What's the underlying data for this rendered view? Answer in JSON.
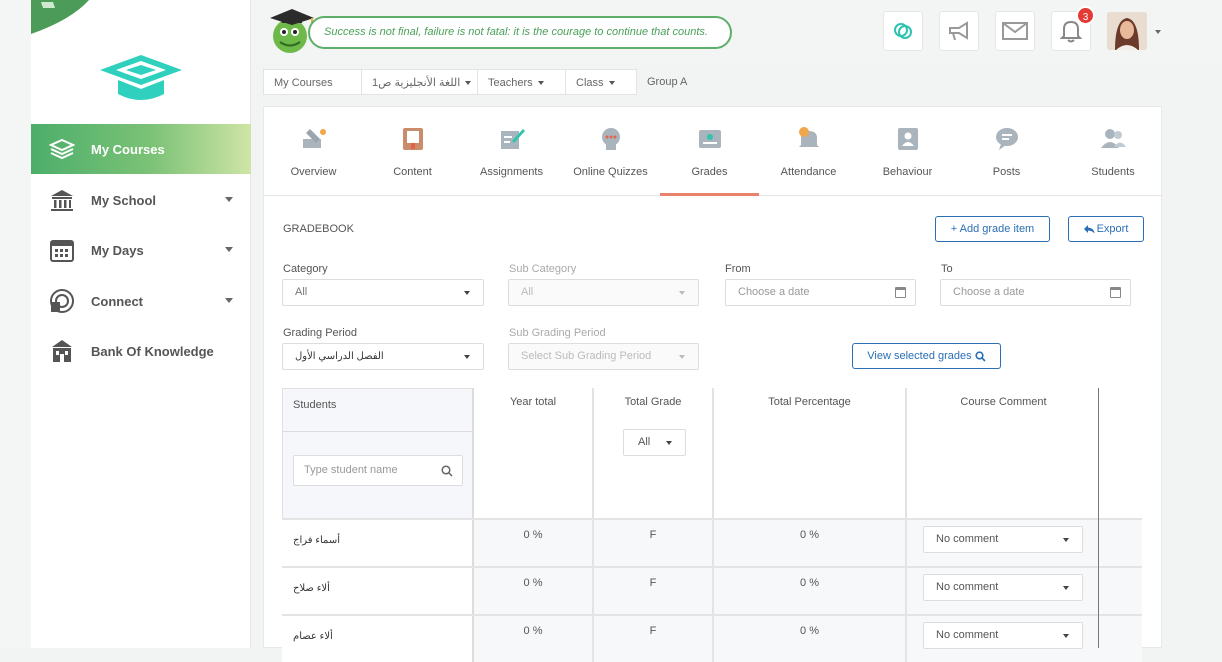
{
  "quote": "Success is not final, failure is not fatal: it is the courage to continue that counts.",
  "notifications_count": "3",
  "sidebar": {
    "items": [
      {
        "label": "My Courses",
        "icon": "layers-icon"
      },
      {
        "label": "My School",
        "icon": "school-building-icon"
      },
      {
        "label": "My Days",
        "icon": "calendar-icon"
      },
      {
        "label": "Connect",
        "icon": "connect-icon"
      },
      {
        "label": "Bank Of Knowledge",
        "icon": "bank-icon"
      }
    ]
  },
  "breadcrumb": [
    "My Courses",
    "اللغة الأنجليزية ص1",
    "Teachers",
    "Class",
    "Group A"
  ],
  "tabs": [
    {
      "label": "Overview",
      "icon": "overview-icon"
    },
    {
      "label": "Content",
      "icon": "book-icon"
    },
    {
      "label": "Assignments",
      "icon": "assignment-icon"
    },
    {
      "label": "Online Quizzes",
      "icon": "quiz-icon"
    },
    {
      "label": "Grades",
      "icon": "grades-icon"
    },
    {
      "label": "Attendance",
      "icon": "bell-clock-icon"
    },
    {
      "label": "Behaviour",
      "icon": "behaviour-icon"
    },
    {
      "label": "Posts",
      "icon": "posts-icon"
    },
    {
      "label": "Students",
      "icon": "students-icon"
    }
  ],
  "gradebook": {
    "title": "GRADEBOOK",
    "add_label": "+ Add grade item",
    "export_label": "Export",
    "view_label": "View selected grades",
    "filters": {
      "category_label": "Category",
      "category_value": "All",
      "subcategory_label": "Sub Category",
      "subcategory_value": "All",
      "from_label": "From",
      "from_placeholder": "Choose a date",
      "to_label": "To",
      "to_placeholder": "Choose a date",
      "grading_period_label": "Grading Period",
      "grading_period_value": "الفصل الدراسي الأول",
      "sub_grading_period_label": "Sub Grading Period",
      "sub_grading_period_value": "Select Sub Grading Period"
    }
  },
  "table": {
    "students_header": "Students",
    "search_placeholder": "Type student name",
    "columns": [
      "Year total",
      "Total Grade",
      "Total Percentage",
      "Course Comment"
    ],
    "total_grade_filter": "All",
    "rows": [
      {
        "name": "أسماء فراج",
        "year_total": "0 %",
        "total_grade": "F",
        "total_percentage": "0 %",
        "comment": "No comment"
      },
      {
        "name": "ألاء صلاح",
        "year_total": "0 %",
        "total_grade": "F",
        "total_percentage": "0 %",
        "comment": "No comment"
      },
      {
        "name": "ألاء عصام",
        "year_total": "0 %",
        "total_grade": "F",
        "total_percentage": "0 %",
        "comment": "No comment"
      }
    ]
  }
}
